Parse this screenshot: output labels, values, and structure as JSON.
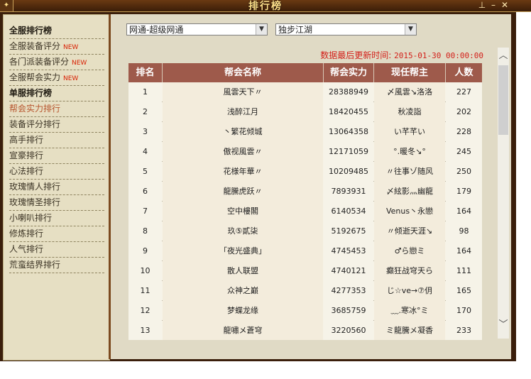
{
  "window": {
    "title": "排行榜"
  },
  "sidebar": {
    "items": [
      {
        "label": "全服排行榜",
        "type": "header"
      },
      {
        "label": "全服装备评分",
        "new": "NEW"
      },
      {
        "label": "各门派装备评分",
        "new": "NEW"
      },
      {
        "label": "全服帮会实力",
        "new": "NEW"
      },
      {
        "label": "单服排行榜",
        "type": "header"
      },
      {
        "label": "帮会实力排行",
        "active": true
      },
      {
        "label": "装备评分排行"
      },
      {
        "label": "高手排行"
      },
      {
        "label": "宣豪排行"
      },
      {
        "label": "心法排行"
      },
      {
        "label": "玫瑰情人排行"
      },
      {
        "label": "玫瑰情圣排行"
      },
      {
        "label": "小喇叭排行"
      },
      {
        "label": "修炼排行"
      },
      {
        "label": "人气排行"
      },
      {
        "label": "荒蛮结界排行"
      }
    ]
  },
  "filters": {
    "server_group": "网通-超级网通",
    "server": "独步江湖"
  },
  "update": {
    "label": "数据最后更新时间:",
    "datetime": "2015-01-30 00:00:00"
  },
  "table": {
    "columns": [
      "排名",
      "帮会名称",
      "帮会实力",
      "现任帮主",
      "人数"
    ],
    "rows": [
      [
        "1",
        "風雲天下〃",
        "28388949",
        "〆風雲↘洛洛",
        "227"
      ],
      [
        "2",
        "浅醉江月",
        "18420455",
        "秋凌詣",
        "202"
      ],
      [
        "3",
        "丶繁花倾城",
        "13064358",
        "い芊芊い",
        "228"
      ],
      [
        "4",
        "傲视風雲〃",
        "12171059",
        "°.暖冬↘°",
        "245"
      ],
      [
        "5",
        "花様年華〃",
        "10209485",
        "〃往事ゾ随风",
        "250"
      ],
      [
        "6",
        "龍騰虎跃〃",
        "7893931",
        "〆絃影灬幽龍",
        "179"
      ],
      [
        "7",
        "空中樓閣",
        "6140534",
        "Venus丶永戀",
        "164"
      ],
      [
        "8",
        "玖⑤貳柒",
        "5192675",
        "〃倾逝天涯↘",
        "98"
      ],
      [
        "9",
        "「夜光盛典」",
        "4745453",
        "♂ら戀ミ",
        "164"
      ],
      [
        "10",
        "散人联盟",
        "4740121",
        "癫狂战穹天ら",
        "111"
      ],
      [
        "11",
        "众神之巅",
        "4277353",
        "じ☆ve→⑦仴",
        "165"
      ],
      [
        "12",
        "梦蝶龙缘",
        "3685759",
        "﹏.寒冰°ミ",
        "170"
      ],
      [
        "13",
        "龍嘯メ蒼穹",
        "3220560",
        "ミ龍騰メ凝香",
        "233"
      ]
    ]
  },
  "colors": {
    "accent_red": "#d3201a",
    "header_bg": "#9e5a4b",
    "frame": "#3a1e0b"
  }
}
